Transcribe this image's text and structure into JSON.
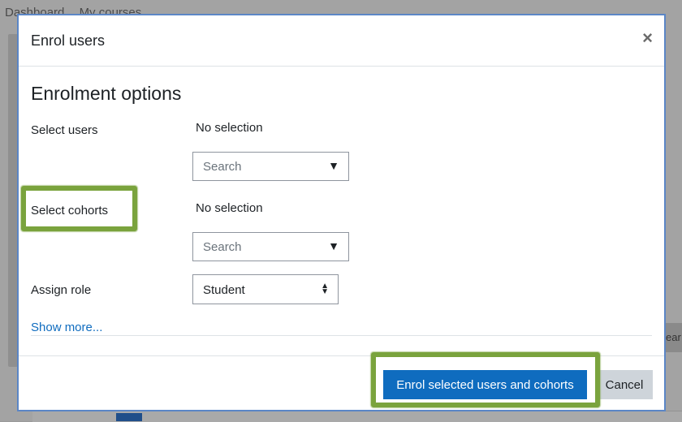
{
  "background": {
    "breadcrumb": [
      "Dashboard",
      "My courses"
    ],
    "side_text": "ear"
  },
  "modal": {
    "title": "Enrol users",
    "close_symbol": "×",
    "section_title": "Enrolment options",
    "select_users": {
      "label": "Select users",
      "selection": "No selection",
      "placeholder": "Search",
      "arrow": "▼"
    },
    "select_cohorts": {
      "label": "Select cohorts",
      "selection": "No selection",
      "placeholder": "Search",
      "arrow": "▼"
    },
    "assign_role": {
      "label": "Assign role",
      "value": "Student",
      "arrows": "▲▼"
    },
    "show_more": "Show more...",
    "buttons": {
      "enrol": "Enrol selected users and cohorts",
      "cancel": "Cancel"
    }
  },
  "colors": {
    "primary": "#0f6cbf",
    "highlight": "#7aa33d",
    "modal_border": "#5b86c6"
  }
}
